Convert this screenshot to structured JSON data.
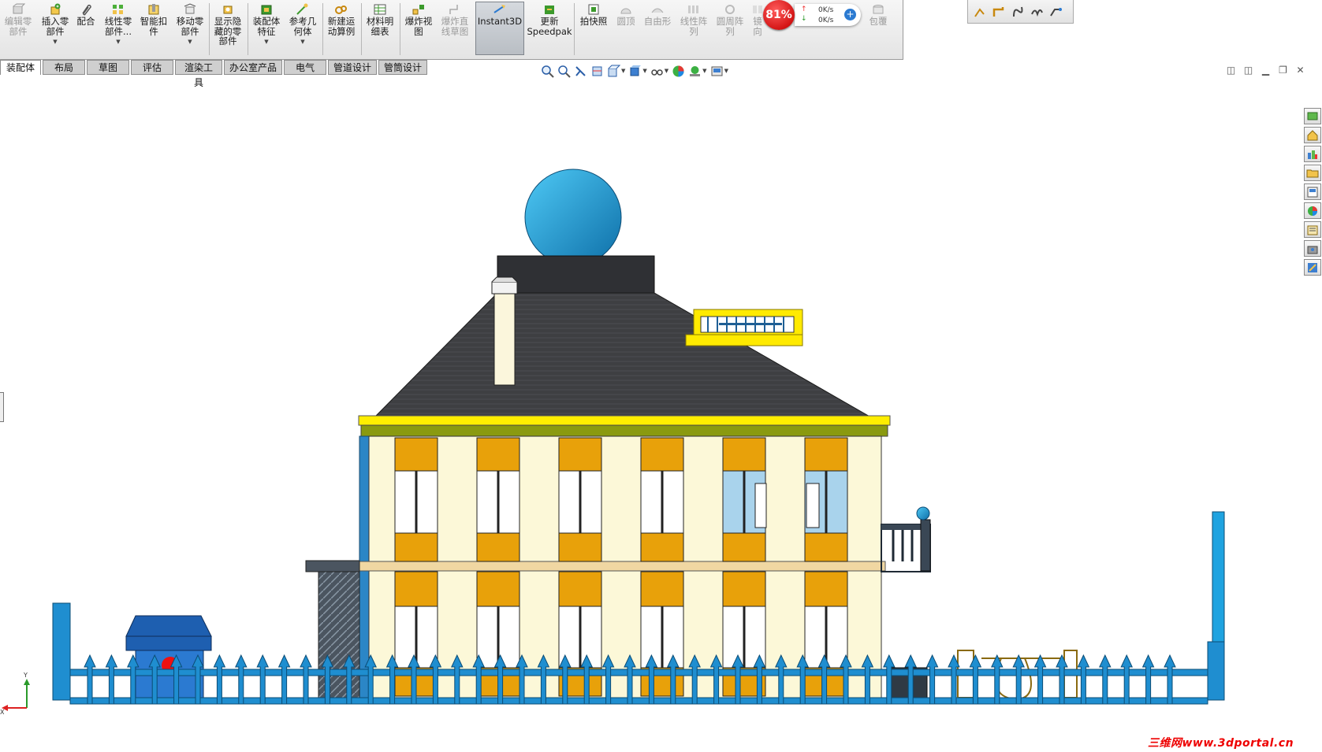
{
  "toolbar": {
    "buttons": [
      {
        "label": "编辑零\n部件",
        "state": "disabled"
      },
      {
        "label": "插入零\n部件",
        "state": "enabled"
      },
      {
        "label": "配合",
        "state": "enabled"
      },
      {
        "label": "线性零\n部件...",
        "state": "enabled"
      },
      {
        "label": "智能扣\n件",
        "state": "enabled"
      },
      {
        "label": "移动零\n部件",
        "state": "enabled"
      },
      {
        "label": "显示隐\n藏的零\n部件",
        "state": "enabled"
      },
      {
        "label": "装配体\n特征",
        "state": "enabled"
      },
      {
        "label": "参考几\n何体",
        "state": "enabled"
      },
      {
        "label": "新建运\n动算例",
        "state": "enabled"
      },
      {
        "label": "材料明\n细表",
        "state": "enabled"
      },
      {
        "label": "爆炸视\n图",
        "state": "enabled"
      },
      {
        "label": "爆炸直\n线草图",
        "state": "disabled"
      },
      {
        "label": "Instant3D",
        "state": "pressed"
      },
      {
        "label": "更新\nSpeedpak",
        "state": "enabled"
      },
      {
        "label": "拍快照",
        "state": "enabled"
      },
      {
        "label": "圆顶",
        "state": "disabled"
      },
      {
        "label": "自由形",
        "state": "disabled"
      },
      {
        "label": "线性阵\n列",
        "state": "disabled"
      },
      {
        "label": "圆周阵\n列",
        "state": "disabled"
      },
      {
        "label": "镜向",
        "state": "disabled"
      },
      {
        "label": "包覆",
        "state": "disabled"
      }
    ]
  },
  "speed_widget": {
    "percent": "81%",
    "up": "0K/s",
    "down": "0K/s"
  },
  "tabs": [
    "装配体",
    "布局",
    "草图",
    "评估",
    "渲染工具",
    "办公室产品",
    "电气",
    "管道设计",
    "管筒设计"
  ],
  "active_tab": "装配体",
  "watermark": "三维网www.3dportal.cn",
  "triad": {
    "x_label": "X",
    "y_label": "Y"
  }
}
